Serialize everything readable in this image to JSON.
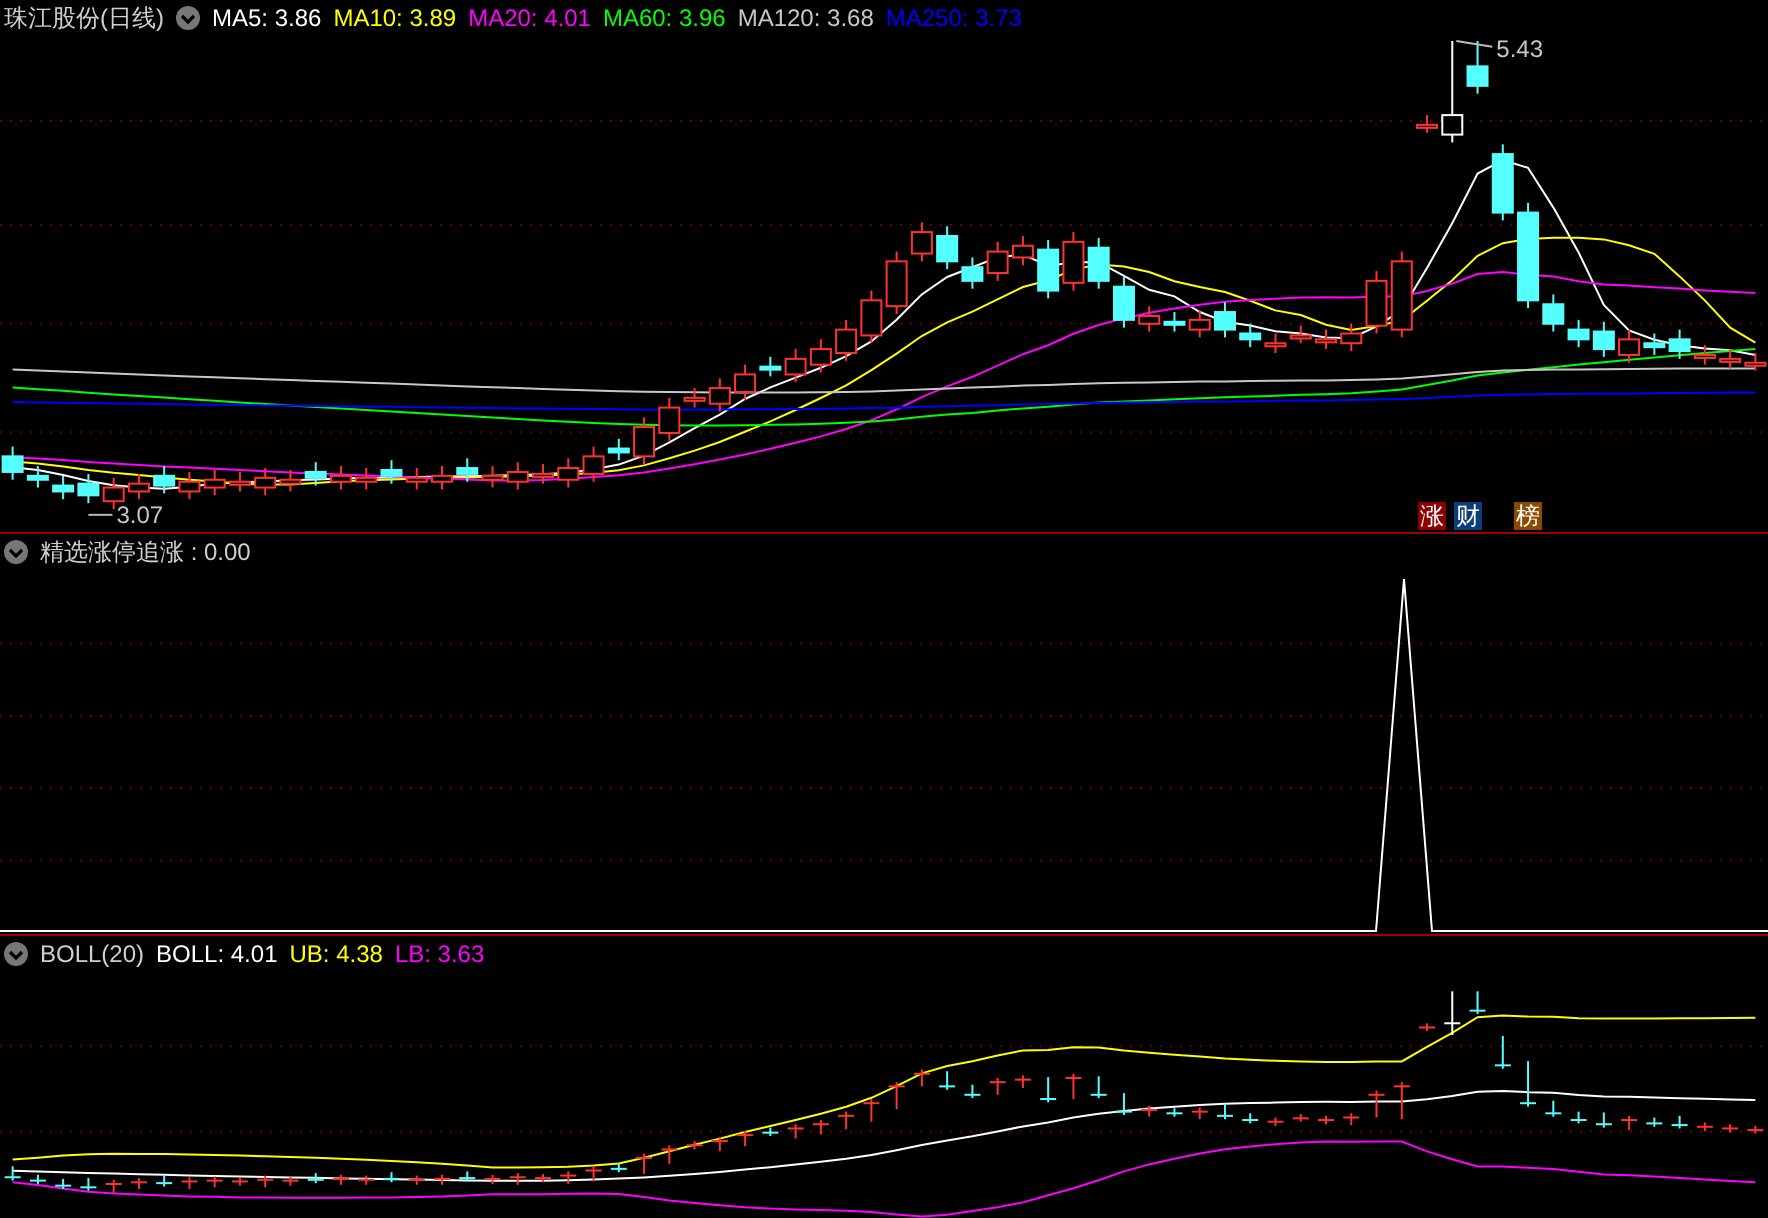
{
  "price_panel": {
    "title": "珠江股份(日线)",
    "indicators": [
      {
        "label": "MA5: 3.86",
        "color": "#ffffff"
      },
      {
        "label": "MA10: 3.89",
        "color": "#ffff00"
      },
      {
        "label": "MA20: 4.01",
        "color": "#ff00ff"
      },
      {
        "label": "MA60: 3.96",
        "color": "#00ff00"
      },
      {
        "label": "MA120: 3.68",
        "color": "#c8c8c8"
      },
      {
        "label": "MA250: 3.73",
        "color": "#0000ff"
      }
    ],
    "high_label": "5.43",
    "low_label": "3.07",
    "badges": [
      {
        "text": "涨",
        "color": "#8b0000"
      },
      {
        "text": "财",
        "color": "#0b3d7a"
      },
      {
        "text": "榜",
        "color": "#8a4a00"
      }
    ]
  },
  "signal_panel": {
    "title": "精选涨停追涨 : 0.00"
  },
  "boll_panel": {
    "title": "BOLL(20)",
    "indicators": [
      {
        "label": "BOLL: 4.01",
        "color": "#ffffff"
      },
      {
        "label": "UB: 4.38",
        "color": "#ffff00"
      },
      {
        "label": "LB: 3.63",
        "color": "#ff00ff"
      }
    ]
  }
}
